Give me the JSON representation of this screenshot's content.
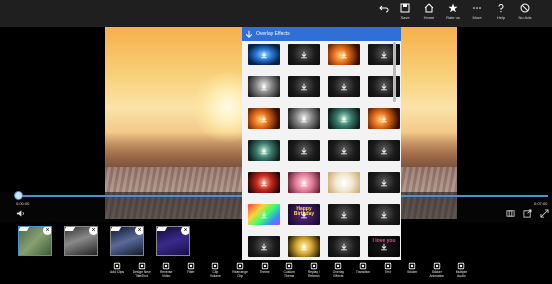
{
  "topbar": {
    "buttons": [
      {
        "label": "",
        "icon": "undo-icon"
      },
      {
        "label": "Save",
        "icon": "save-icon"
      },
      {
        "label": "Home",
        "icon": "home-icon"
      },
      {
        "label": "Rate us",
        "icon": "star-icon"
      },
      {
        "label": "More",
        "icon": "more-icon"
      },
      {
        "label": "Help",
        "icon": "help-icon"
      },
      {
        "label": "No Ads",
        "icon": "no-ads-icon"
      }
    ]
  },
  "panel": {
    "title": "Overlay Effects",
    "colors": {
      "header": "#2f6fd6",
      "background": "#f3f3f3"
    }
  },
  "timeline": {
    "start_time": "0:00:00",
    "end_time": "0:07:00",
    "progress": 0.0
  },
  "clips": [
    {
      "selected": true
    },
    {
      "selected": false
    },
    {
      "selected": false
    },
    {
      "selected": false
    }
  ],
  "toolbar": {
    "buttons": [
      {
        "label": "Add Clips",
        "icon": "add-clips-icon"
      },
      {
        "label": "Design New\nTitle/End",
        "icon": "design-title-icon"
      },
      {
        "label": "Reverse\nVideo",
        "icon": "reverse-video-icon"
      },
      {
        "label": "Filter",
        "icon": "filter-icon"
      },
      {
        "label": "Clip\nVolume",
        "icon": "clip-volume-icon"
      },
      {
        "label": "Rearrange\nClip",
        "icon": "rearrange-clip-icon"
      },
      {
        "label": "Theme",
        "icon": "theme-icon"
      },
      {
        "label": "Custom\nTheme",
        "icon": "custom-theme-icon"
      },
      {
        "label": "Replay /\nRefresh",
        "icon": "replay-refresh-icon"
      },
      {
        "label": "Overlay\nEffects",
        "icon": "overlay-effects-icon"
      },
      {
        "label": "Transition",
        "icon": "transition-icon"
      },
      {
        "label": "Text",
        "icon": "text-icon"
      },
      {
        "label": "Sticker",
        "icon": "sticker-icon"
      },
      {
        "label": "Sticker\nAnimation",
        "icon": "sticker-animation-icon"
      },
      {
        "label": "Multiple\nAudio",
        "icon": "multiple-audio-icon"
      }
    ]
  },
  "overlay_grid": {
    "columns": 4,
    "items": [
      {
        "style": "blue-eye"
      },
      {
        "style": "dark"
      },
      {
        "style": "fire"
      },
      {
        "style": "dark"
      },
      {
        "style": "light"
      },
      {
        "style": "dark"
      },
      {
        "style": "dark"
      },
      {
        "style": "dark"
      },
      {
        "style": "fire"
      },
      {
        "style": "light"
      },
      {
        "style": "teal"
      },
      {
        "style": "fire"
      },
      {
        "style": "teal"
      },
      {
        "style": "dark"
      },
      {
        "style": "dark"
      },
      {
        "style": "dark"
      },
      {
        "style": "red"
      },
      {
        "style": "pink"
      },
      {
        "style": "bright"
      },
      {
        "style": "dark"
      },
      {
        "style": "colorful"
      },
      {
        "style": "birthday",
        "text": "Happy Birthday"
      },
      {
        "style": "dark"
      },
      {
        "style": "dark"
      },
      {
        "style": "dark"
      },
      {
        "style": "gold"
      },
      {
        "style": "dark"
      },
      {
        "style": "love",
        "text": "I love you"
      }
    ]
  }
}
